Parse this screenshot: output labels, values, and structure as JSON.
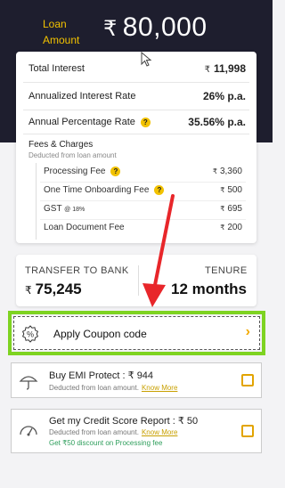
{
  "header": {
    "loan_label_line1": "Loan",
    "loan_label_line2": "Amount",
    "currency": "₹",
    "loan_amount": "80,000"
  },
  "breakdown": {
    "total_interest_label": "Total Interest",
    "total_interest_value": "11,998",
    "annualized_rate_label": "Annualized Interest Rate",
    "annualized_rate_value": "26% p.a.",
    "apr_label": "Annual Percentage Rate",
    "apr_value": "35.56% p.a.",
    "fees_title": "Fees & Charges",
    "fees_subtitle": "Deducted from loan amount",
    "fees": [
      {
        "label": "Processing Fee",
        "value": "3,360",
        "has_help": true
      },
      {
        "label": "One Time Onboarding Fee",
        "value": "500",
        "has_help": true
      },
      {
        "label": "GST",
        "label_suffix": "@ 18%",
        "value": "695",
        "has_help": false
      },
      {
        "label": "Loan Document Fee",
        "value": "200",
        "has_help": false
      }
    ],
    "help_glyph": "?"
  },
  "transfer": {
    "transfer_label": "TRANSFER TO BANK",
    "transfer_value": "75,245",
    "tenure_label": "TENURE",
    "tenure_value": "12 months"
  },
  "coupon": {
    "label": "Apply Coupon code",
    "icon_glyph": "%",
    "chevron": "›"
  },
  "addons": [
    {
      "title": "Buy EMI Protect : ₹ 944",
      "subtitle": "Deducted from loan amount.",
      "link": "Know More",
      "icon": "umbrella-icon"
    },
    {
      "title": "Get my Credit Score Report : ₹ 50",
      "subtitle": "Deducted from loan amount.",
      "link": "Know More",
      "offer": "Get ₹50 discount on Processing fee",
      "icon": "gauge-icon"
    }
  ],
  "colors": {
    "header_bg": "#1e1e2e",
    "accent_yellow": "#f2c200",
    "highlight_green": "#7ed321",
    "annotation_red": "#e8262a",
    "offer_green": "#2e9e5b"
  }
}
